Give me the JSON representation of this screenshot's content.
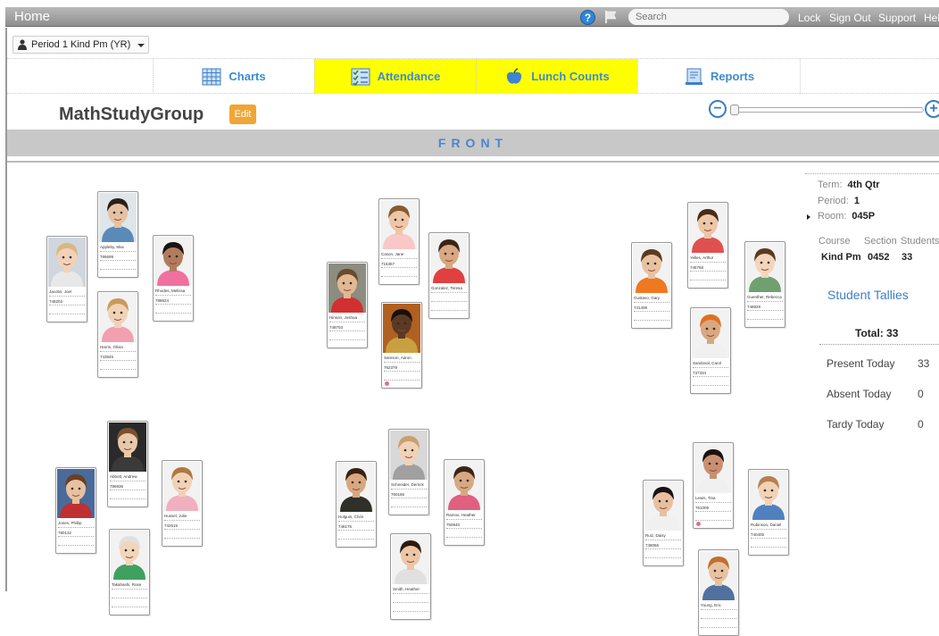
{
  "topbar": {
    "home": "Home",
    "search_placeholder": "Search",
    "links": [
      "Lock",
      "Sign Out",
      "Support",
      "Help"
    ]
  },
  "period_select": {
    "value": "Period 1 Kind Pm (YR)"
  },
  "nav": {
    "tabs": [
      {
        "label": "Charts",
        "icon": "grid-icon",
        "highlighted": false
      },
      {
        "label": "Attendance",
        "icon": "checklist-icon",
        "highlighted": true
      },
      {
        "label": "Lunch Counts",
        "icon": "apple-icon",
        "highlighted": false
      },
      {
        "label": "Reports",
        "icon": "report-icon",
        "highlighted": false
      }
    ],
    "highlight_color": "#ffff00"
  },
  "group": {
    "title": "MathStudyGroup",
    "edit_label": "Edit"
  },
  "front_label": "FRONT",
  "info": {
    "term_label": "Term:",
    "term": "4th Qtr",
    "period_label": "Period:",
    "period": "1",
    "room_label": "Room:",
    "room": "045P",
    "course_header": "Course",
    "section_header": "Section",
    "students_header": "Students",
    "course": "Kind Pm",
    "section": "0452",
    "students": "33",
    "tallies_title": "Student Tallies",
    "total": "Total: 33",
    "stats": [
      {
        "label": "Present Today",
        "value": "33"
      },
      {
        "label": "Absent Today",
        "value": "0"
      },
      {
        "label": "Tardy Today",
        "value": "0"
      }
    ]
  },
  "students": [
    {
      "name": "Jacobs, Joel",
      "id": "748203",
      "skin": "#f1d2b8",
      "hair": "#d8b880",
      "shirt": "#e8e8e8",
      "bg": "#cfd6de"
    },
    {
      "name": "Appleby, Max",
      "id": "786699",
      "skin": "#e6c2a4",
      "hair": "#2a2018",
      "shirt": "#5a8ab8",
      "bg": "#dfe6ea"
    },
    {
      "name": "Harris, Olivia",
      "id": "743845",
      "skin": "#f2d2b6",
      "hair": "#c89a5c",
      "shirt": "#f2a0b0",
      "bg": "#f2f2f2"
    },
    {
      "name": "Rhodes, Melissa",
      "id": "788624",
      "skin": "#b07c5c",
      "hair": "#1a1410",
      "shirt": "#f070a0",
      "bg": "#f2f2f2"
    },
    {
      "name": "Hinson, Joshua",
      "id": "748703",
      "skin": "#e2b894",
      "hair": "#6a4a2a",
      "shirt": "#d03030",
      "bg": "#8c8c80"
    },
    {
      "name": "Cason, Jane",
      "id": "715357",
      "skin": "#edc6a6",
      "hair": "#8a5a30",
      "shirt": "#f8c8c8",
      "bg": "#f2f2f2"
    },
    {
      "name": "Samson, Aaron",
      "id": "762379",
      "skin": "#5a3a24",
      "hair": "#1a1008",
      "shirt": "#c8a040",
      "bg": "#b06020",
      "flag": true
    },
    {
      "name": "Gonzalez, Teresa",
      "id": "",
      "skin": "#d8a880",
      "hair": "#3a2418",
      "shirt": "#e04040",
      "bg": "#f2f2f2"
    },
    {
      "name": "Gustavo, Gary",
      "id": "741408",
      "skin": "#e8c2a0",
      "hair": "#5a3a20",
      "shirt": "#f07820",
      "bg": "#f2f2f2"
    },
    {
      "name": "Yelles, Arthur",
      "id": "746768",
      "skin": "#edc6a6",
      "hair": "#4a2a18",
      "shirt": "#e05050",
      "bg": "#f2f2f2"
    },
    {
      "name": "Sandoval, Carol",
      "id": "737334",
      "skin": "#d8a880",
      "hair": "#e07020",
      "shirt": "#f0f0f0",
      "bg": "#f2f2f2"
    },
    {
      "name": "Guenther, Rebecca",
      "id": "748829",
      "skin": "#f2d6bc",
      "hair": "#5a3a20",
      "shirt": "#70a070",
      "bg": "#f2f2f2"
    },
    {
      "name": "Jones, Phillip",
      "id": "780132",
      "skin": "#e8c2a0",
      "hair": "#6a4020",
      "shirt": "#c03030",
      "bg": "#4a6a9a"
    },
    {
      "name": "Abbott, Andrew",
      "id": "786936",
      "skin": "#e8c8a8",
      "hair": "#7a5030",
      "shirt": "#3a3a3a",
      "bg": "#2a2a2a"
    },
    {
      "name": "Hussel, Julie",
      "id": "742515",
      "skin": "#f2d2b6",
      "hair": "#b07840",
      "shirt": "#f0b0c0",
      "bg": "#f2f2f2"
    },
    {
      "name": "Takahashi, Rose",
      "id": "",
      "skin": "#f2d6bc",
      "hair": "#e0e0e0",
      "shirt": "#40a060",
      "bg": "#f2f2f2"
    },
    {
      "name": "Holguin, Chris",
      "id": "748175",
      "skin": "#d8a880",
      "hair": "#3a2010",
      "shirt": "#30302a",
      "bg": "#f2f2f2"
    },
    {
      "name": "Schneider, Derrick",
      "id": "760165",
      "skin": "#f2d2b6",
      "hair": "#c8a070",
      "shirt": "#a0a0a0",
      "bg": "#d8d8d8"
    },
    {
      "name": "Ramos, Heather",
      "id": "750940",
      "skin": "#d8a880",
      "hair": "#3a2418",
      "shirt": "#e06080",
      "bg": "#f2f2f2"
    },
    {
      "name": "Smith, Heather",
      "id": "",
      "skin": "#edc6a6",
      "hair": "#2a1a10",
      "shirt": "#e0e0e0",
      "bg": "#f2f2f2"
    },
    {
      "name": "Ruiz, Daisy",
      "id": "748066",
      "skin": "#e8c0a0",
      "hair": "#1a1210",
      "shirt": "#f0f0f0",
      "bg": "#f2f2f2"
    },
    {
      "name": "Lewis, Tina",
      "id": "761009",
      "skin": "#c89070",
      "hair": "#1a1210",
      "shirt": "#f0f0f0",
      "bg": "#f2f2f2",
      "flag": true
    },
    {
      "name": "Robinson, Daniel",
      "id": "740405",
      "skin": "#f2d2b6",
      "hair": "#b88050",
      "shirt": "#5080c0",
      "bg": "#f2f2f2"
    },
    {
      "name": "Young, Eric",
      "id": "",
      "skin": "#e8c2a0",
      "hair": "#c07030",
      "shirt": "#5070a0",
      "bg": "#f2f2f2"
    }
  ]
}
